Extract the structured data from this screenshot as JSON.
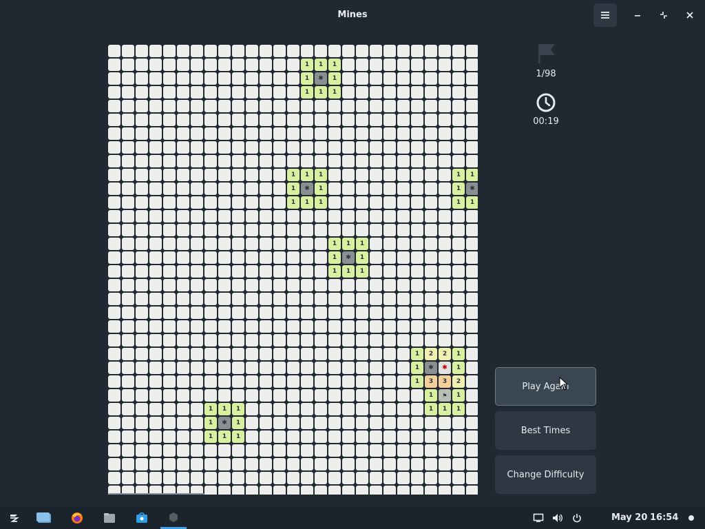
{
  "window": {
    "title": "Mines"
  },
  "icons": {
    "menu": "hamburger-menu-icon",
    "minimize": "minimize-icon",
    "restore": "restore-icon",
    "close": "close-icon",
    "flag": "flag-icon",
    "clock": "clock-icon"
  },
  "status": {
    "flags": "1/98",
    "time": "00:19"
  },
  "buttons": {
    "play_again": "Play Again",
    "best_times": "Best Times",
    "change_difficulty": "Change Difficulty"
  },
  "board": {
    "columns": 27,
    "rows": 33,
    "revealed": [
      [
        1,
        14,
        "1"
      ],
      [
        1,
        15,
        "1"
      ],
      [
        1,
        16,
        "1"
      ],
      [
        2,
        14,
        "1"
      ],
      [
        2,
        15,
        "*"
      ],
      [
        2,
        16,
        "1"
      ],
      [
        3,
        14,
        "1"
      ],
      [
        3,
        15,
        "1"
      ],
      [
        3,
        16,
        "1"
      ],
      [
        9,
        13,
        "1"
      ],
      [
        9,
        14,
        "1"
      ],
      [
        9,
        15,
        "1"
      ],
      [
        10,
        13,
        "1"
      ],
      [
        10,
        14,
        "*"
      ],
      [
        10,
        15,
        "1"
      ],
      [
        11,
        13,
        "1"
      ],
      [
        11,
        14,
        "1"
      ],
      [
        11,
        15,
        "1"
      ],
      [
        9,
        25,
        "1"
      ],
      [
        9,
        26,
        "1"
      ],
      [
        10,
        25,
        "1"
      ],
      [
        10,
        26,
        "*"
      ],
      [
        11,
        25,
        "1"
      ],
      [
        11,
        26,
        "1"
      ],
      [
        14,
        16,
        "1"
      ],
      [
        14,
        17,
        "1"
      ],
      [
        14,
        18,
        "1"
      ],
      [
        15,
        16,
        "1"
      ],
      [
        15,
        17,
        "*"
      ],
      [
        15,
        18,
        "1"
      ],
      [
        16,
        16,
        "1"
      ],
      [
        16,
        17,
        "1"
      ],
      [
        16,
        18,
        "1"
      ],
      [
        22,
        22,
        "1"
      ],
      [
        22,
        23,
        "2"
      ],
      [
        22,
        24,
        "2"
      ],
      [
        22,
        25,
        "1"
      ],
      [
        23,
        22,
        "1"
      ],
      [
        23,
        23,
        "*"
      ],
      [
        23,
        24,
        "X"
      ],
      [
        23,
        25,
        "1"
      ],
      [
        24,
        22,
        "1"
      ],
      [
        24,
        23,
        "3"
      ],
      [
        24,
        24,
        "3"
      ],
      [
        24,
        25,
        "2"
      ],
      [
        25,
        23,
        "1"
      ],
      [
        25,
        24,
        "F"
      ],
      [
        25,
        25,
        "1"
      ],
      [
        26,
        23,
        "1"
      ],
      [
        26,
        24,
        "1"
      ],
      [
        26,
        25,
        "1"
      ],
      [
        26,
        7,
        "1"
      ],
      [
        26,
        8,
        "1"
      ],
      [
        26,
        9,
        "1"
      ],
      [
        27,
        7,
        "1"
      ],
      [
        27,
        8,
        "*"
      ],
      [
        27,
        9,
        "1"
      ],
      [
        28,
        7,
        "1"
      ],
      [
        28,
        8,
        "1"
      ],
      [
        28,
        9,
        "1"
      ]
    ]
  },
  "taskbar": {
    "items": [
      "zorin-menu-icon",
      "workspace-switcher-icon",
      "firefox-icon",
      "files-icon",
      "software-store-icon",
      "mines-app-icon"
    ],
    "tray": [
      "display-icon",
      "volume-icon",
      "power-icon"
    ],
    "date": "May 20",
    "time": "16:54"
  },
  "colors": {
    "background": "#202932",
    "cell_unrevealed": "#eeeeec",
    "cell_one": "#d9f0a0",
    "cell_two": "#f0f0b0",
    "cell_three": "#f5cf9a",
    "cell_mine": "#8a8f93",
    "exploded_mine": "#cc0000"
  }
}
